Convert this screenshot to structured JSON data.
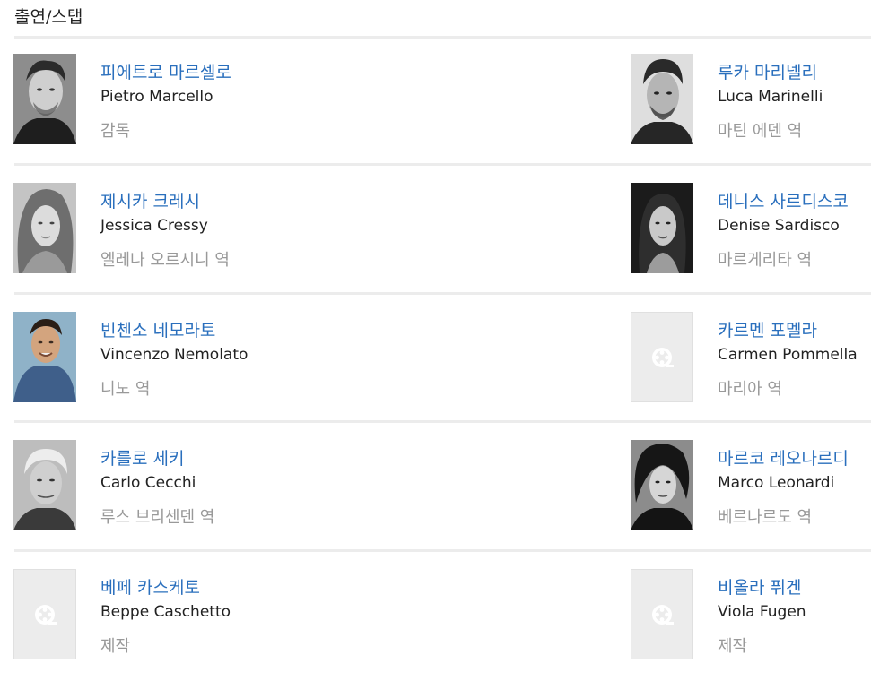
{
  "section": {
    "title": "출연/스탭"
  },
  "colors": {
    "name_link": "#2a6fbd",
    "role_text": "#999999",
    "divider": "#ececec",
    "placeholder_bg": "#ececec"
  },
  "people": [
    {
      "name_ko": "피에트로 마르셀로",
      "name_en": "Pietro Marcello",
      "role": "감독",
      "photo": "portrait"
    },
    {
      "name_ko": "루카 마리넬리",
      "name_en": "Luca Marinelli",
      "role": "마틴 에덴 역",
      "photo": "portrait"
    },
    {
      "name_ko": "제시카 크레시",
      "name_en": "Jessica Cressy",
      "role": "엘레나 오르시니 역",
      "photo": "portrait"
    },
    {
      "name_ko": "데니스 사르디스코",
      "name_en": "Denise Sardisco",
      "role": "마르게리타 역",
      "photo": "portrait"
    },
    {
      "name_ko": "빈첸소 네모라토",
      "name_en": "Vincenzo Nemolato",
      "role": "니노 역",
      "photo": "portrait-color"
    },
    {
      "name_ko": "카르멘 포멜라",
      "name_en": "Carmen Pommella",
      "role": "마리아 역",
      "photo": "film-reel-icon"
    },
    {
      "name_ko": "카를로 세키",
      "name_en": "Carlo Cecchi",
      "role": "루스 브리센덴 역",
      "photo": "portrait"
    },
    {
      "name_ko": "마르코 레오나르디",
      "name_en": "Marco Leonardi",
      "role": "베르나르도 역",
      "photo": "portrait"
    },
    {
      "name_ko": "베페 카스케토",
      "name_en": "Beppe Caschetto",
      "role": "제작",
      "photo": "film-reel-icon"
    },
    {
      "name_ko": "비올라 퓌겐",
      "name_en": "Viola Fugen",
      "role": "제작",
      "photo": "film-reel-icon"
    }
  ]
}
